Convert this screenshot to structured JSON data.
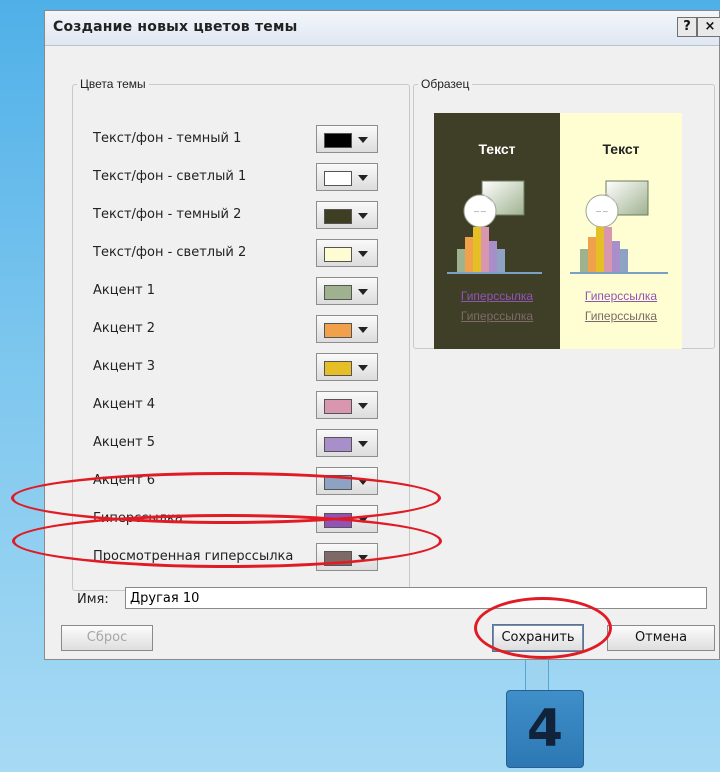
{
  "dialog": {
    "title": "Создание новых цветов темы",
    "help_label": "?",
    "close_label": "×"
  },
  "theme_colors": {
    "legend": "Цвета темы",
    "items": [
      {
        "label": "Текст/фон - темный 1",
        "color": "#000000"
      },
      {
        "label": "Текст/фон - светлый 1",
        "color": "#ffffff"
      },
      {
        "label": "Текст/фон - темный 2",
        "color": "#3e3e23"
      },
      {
        "label": "Текст/фон - светлый 2",
        "color": "#fdfcd2"
      },
      {
        "label": "Акцент 1",
        "color": "#9fb28f"
      },
      {
        "label": "Акцент 2",
        "color": "#f1a14b"
      },
      {
        "label": "Акцент 3",
        "color": "#e6be26"
      },
      {
        "label": "Акцент 4",
        "color": "#d897ae"
      },
      {
        "label": "Акцент 5",
        "color": "#a98fc9"
      },
      {
        "label": "Акцент 6",
        "color": "#8ea2c4"
      },
      {
        "label": "Гиперссылка",
        "color": "#9154b6"
      },
      {
        "label": "Просмотренная гиперссылка",
        "color": "#7d6a67"
      }
    ]
  },
  "sample": {
    "legend": "Образец",
    "dark_title": "Текст",
    "light_title": "Текст",
    "link": "Гиперссылка",
    "visited_link": "Гиперссылка",
    "dark_bg": "#3f3f27",
    "light_bg": "#fffed2"
  },
  "name_field": {
    "label": "Имя:",
    "value": "Другая 10"
  },
  "buttons": {
    "reset": "Сброс",
    "save": "Сохранить",
    "cancel": "Отмена"
  },
  "callout": {
    "number": "4"
  }
}
